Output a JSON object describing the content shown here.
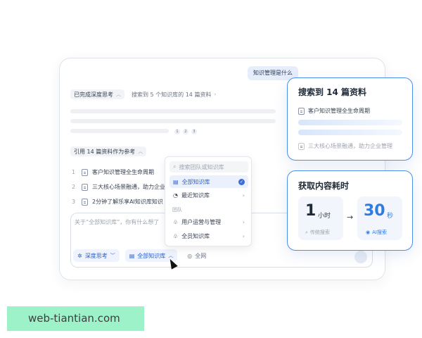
{
  "chat": {
    "user_question": "知识管理是什么",
    "thinking_status": "已完成深度思考",
    "search_summary": "搜索到 5 个知识库的 14 篇资料",
    "pages": [
      "1",
      "2",
      "3"
    ],
    "citation_header": "引用 14 篇资料作为参考",
    "references": [
      {
        "num": "1",
        "title": "客户知识管理全生命周期"
      },
      {
        "num": "2",
        "title": "三大核心场景融通，助力企业"
      },
      {
        "num": "3",
        "title": "2分钟了解乐享AI知识库知识"
      }
    ]
  },
  "input": {
    "placeholder": "关于“全部知识库”，你有什么想了",
    "deep_think_label": "深度思考",
    "kb_label": "全部知识库",
    "web_label": "全网"
  },
  "dropdown": {
    "search_placeholder": "搜索团队或知识库",
    "all_kb": "全部知识库",
    "recent_kb": "最近知识库",
    "group_label": "团队",
    "team_1": "用户运营与管理",
    "team_2": "全员知识库"
  },
  "panel_search": {
    "title": "搜索到 14 篇资料",
    "doc_1": "客户知识管理全生命周期",
    "doc_2": "三大核心场景融通，助力企业管理"
  },
  "panel_time": {
    "title": "获取内容耗时",
    "manual_value": "1",
    "manual_unit": "小时",
    "manual_label": "传统搜索",
    "ai_value": "30",
    "ai_unit": "秒",
    "ai_label": "AI搜索",
    "arrow": "→"
  },
  "watermark": "web-tiantian.com",
  "colors": {
    "accent": "#2d5fc9",
    "panel_border": "#4a8fe8",
    "ai_blue": "#2f7be0",
    "watermark_bg": "#8ef0c0"
  }
}
